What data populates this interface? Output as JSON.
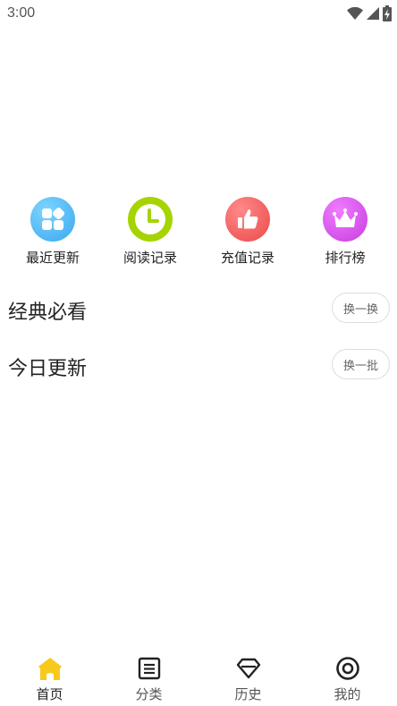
{
  "status_bar": {
    "time": "3:00"
  },
  "quick_actions": [
    {
      "label": "最近更新",
      "icon": "grid-apps-icon",
      "color": "#4ab8f5"
    },
    {
      "label": "阅读记录",
      "icon": "clock-icon",
      "color": "#a6d400"
    },
    {
      "label": "充值记录",
      "icon": "thumbs-up-icon",
      "color": "#f25a5a"
    },
    {
      "label": "排行榜",
      "icon": "crown-icon",
      "color": "#d24ee6"
    }
  ],
  "sections": [
    {
      "title": "经典必看",
      "button_label": "换一换"
    },
    {
      "title": "今日更新",
      "button_label": "换一批"
    }
  ],
  "tab_bar": {
    "tabs": [
      {
        "label": "首页",
        "icon": "home-icon",
        "active": true
      },
      {
        "label": "分类",
        "icon": "category-list-icon",
        "active": false
      },
      {
        "label": "历史",
        "icon": "diamond-icon",
        "active": false
      },
      {
        "label": "我的",
        "icon": "profile-circle-icon",
        "active": false
      }
    ],
    "active_color": "#f7c91a"
  }
}
